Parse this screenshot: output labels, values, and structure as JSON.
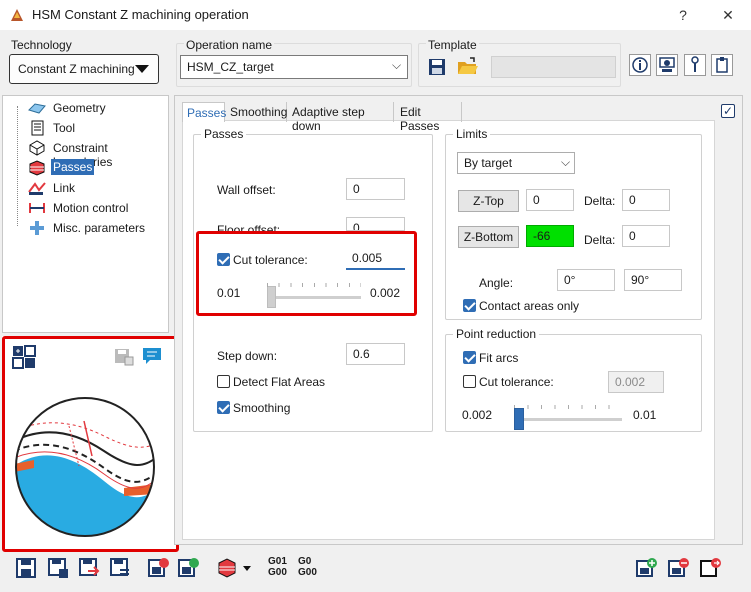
{
  "window": {
    "title": "HSM Constant Z machining operation",
    "help_glyph": "?",
    "close_glyph": "✕"
  },
  "technology": {
    "label": "Technology",
    "value": "Constant Z machining"
  },
  "operation_name": {
    "label": "Operation name",
    "value": "HSM_CZ_target"
  },
  "template": {
    "label": "Template",
    "value": ""
  },
  "tree": {
    "items": [
      {
        "label": "Geometry",
        "icon": "geometry-icon"
      },
      {
        "label": "Tool",
        "icon": "tool-icon"
      },
      {
        "label": "Constraint boundaries",
        "icon": "boundary-icon"
      },
      {
        "label": "Passes",
        "icon": "passes-icon",
        "selected": true
      },
      {
        "label": "Link",
        "icon": "link-icon"
      },
      {
        "label": "Motion control",
        "icon": "motion-control-icon"
      },
      {
        "label": "Misc. parameters",
        "icon": "misc-parameters-icon"
      }
    ]
  },
  "tabs": [
    "Passes",
    "Smoothing",
    "Adaptive step down",
    "Edit Passes"
  ],
  "passes": {
    "title": "Passes",
    "wall_offset_label": "Wall offset:",
    "wall_offset_value": "0",
    "floor_offset_label": "Floor offset:",
    "floor_offset_value": "0",
    "cut_tolerance_label": "Cut tolerance:",
    "cut_tolerance_value": "0.005",
    "cut_tolerance_checked": true,
    "slider_min": "0.01",
    "slider_max": "0.002",
    "step_down_label": "Step down:",
    "step_down_value": "0.6",
    "detect_flat_label": "Detect Flat Areas",
    "detect_flat_checked": false,
    "smoothing_label": "Smoothing",
    "smoothing_checked": true
  },
  "limits": {
    "title": "Limits",
    "mode": "By target",
    "ztop_label": "Z-Top",
    "ztop_value": "0",
    "ztop_delta_label": "Delta:",
    "ztop_delta_value": "0",
    "zbottom_label": "Z-Bottom",
    "zbottom_value": "-66",
    "zbottom_delta_label": "Delta:",
    "zbottom_delta_value": "0",
    "angle_label": "Angle:",
    "angle_from": "0°",
    "angle_to": "90°",
    "contact_label": "Contact areas only",
    "contact_checked": true
  },
  "point_reduction": {
    "title": "Point reduction",
    "fit_arcs_label": "Fit arcs",
    "fit_arcs_checked": true,
    "cut_tolerance_label": "Cut tolerance:",
    "cut_tolerance_value": "0.002",
    "cut_tolerance_checked": false,
    "slider_min": "0.002",
    "slider_max": "0.01"
  },
  "bottom_toolbar": {
    "g01_label": "G01\nG00",
    "g0_label": "G0\nG00"
  },
  "colors": {
    "highlight": "#e00000",
    "accent": "#2f6db5",
    "zbottom_bg": "#00e000",
    "preview_fill": "#29abe2",
    "preview_orange": "#e8602c"
  }
}
